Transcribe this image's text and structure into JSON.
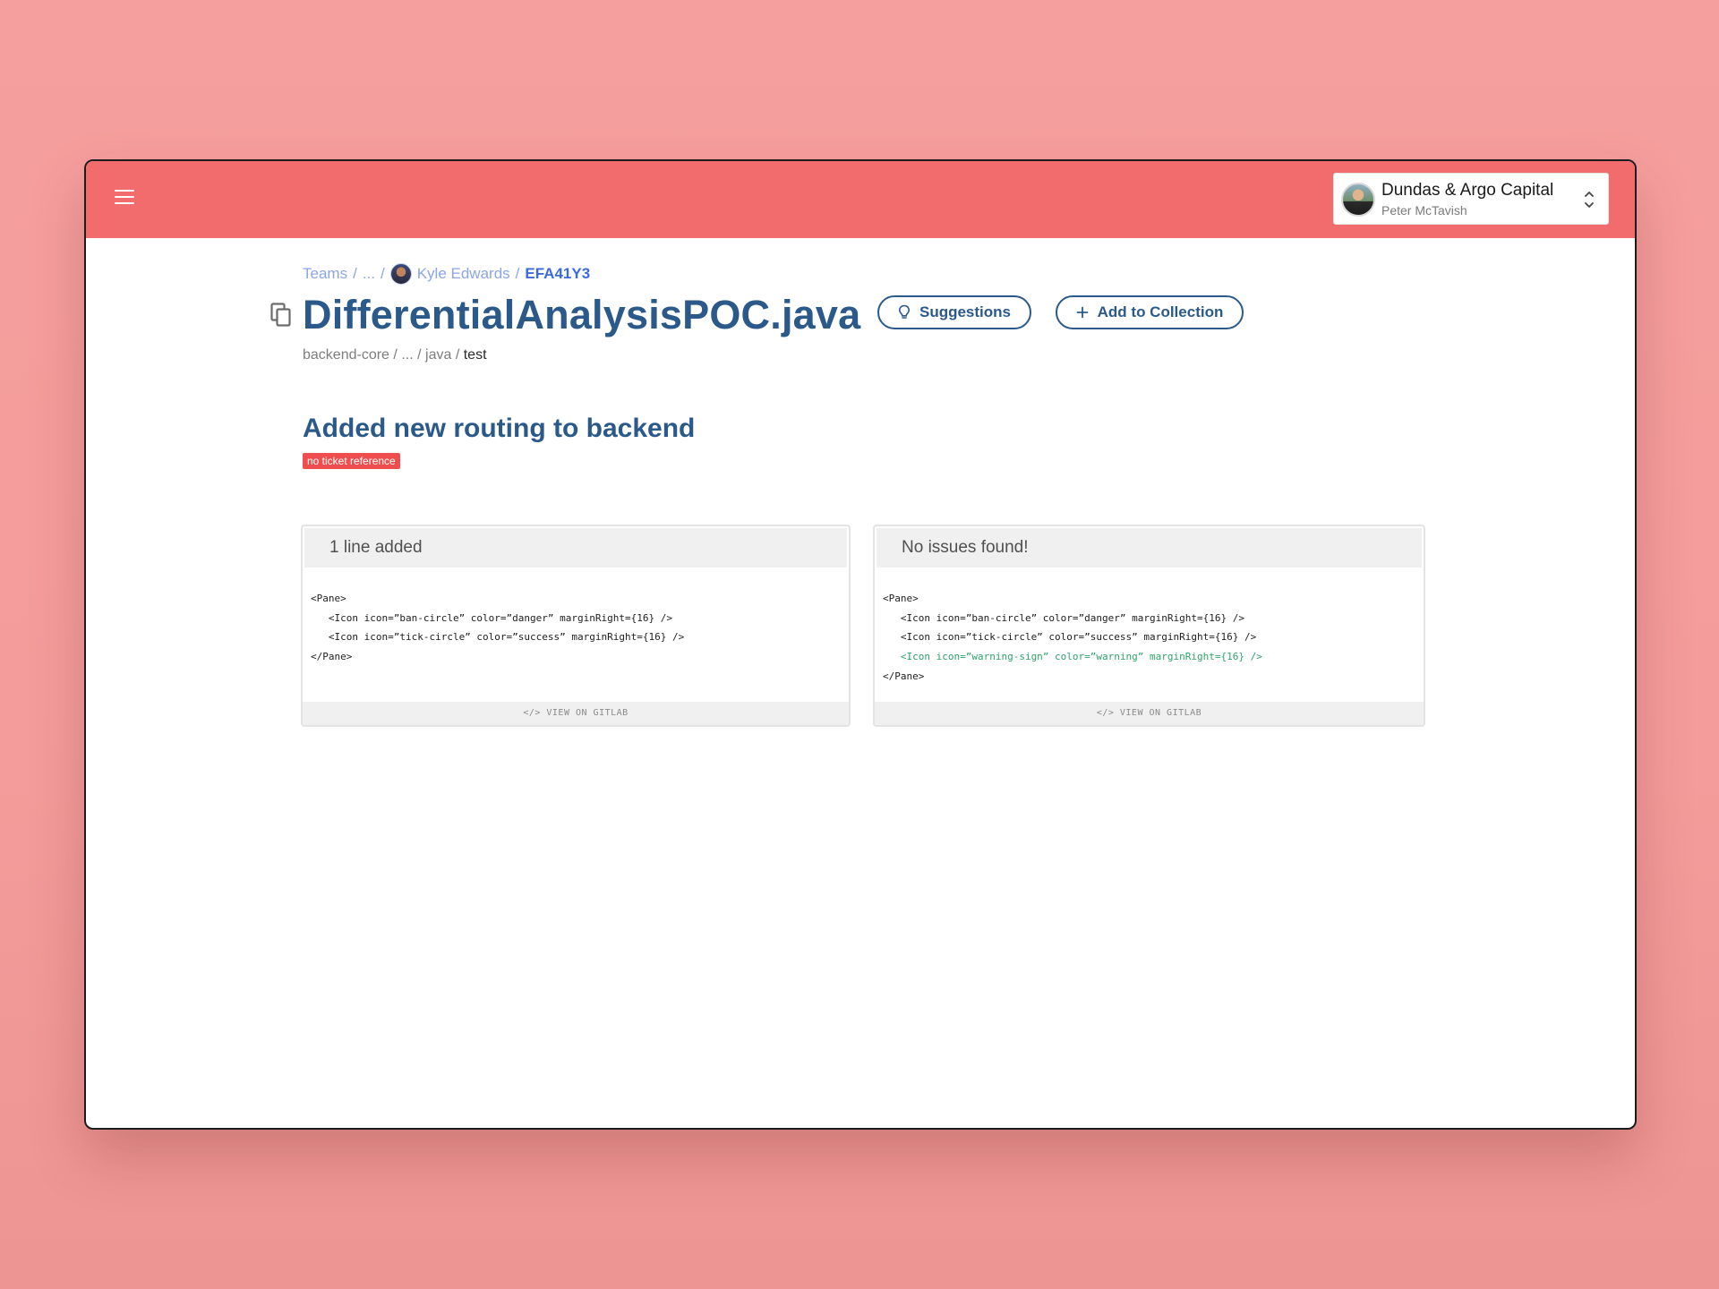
{
  "app": {
    "account": {
      "org": "Dundas & Argo Capital",
      "user": "Peter McTavish"
    }
  },
  "breadcrumb": {
    "teams": "Teams",
    "ellipsis": "...",
    "person": "Kyle Edwards",
    "commit": "EFA41Y3",
    "separator": "/"
  },
  "file": {
    "title": "DifferentialAnalysisPOC.java",
    "path_root": "backend-core",
    "path_ellipsis": "...",
    "path_mid": "java",
    "path_last": "test",
    "path_separator": "/"
  },
  "actions": {
    "suggestions_label": "Suggestions",
    "collection_label": "Add to Collection"
  },
  "commit": {
    "title": "Added new routing to backend",
    "badge": "no ticket reference"
  },
  "panels": {
    "left": {
      "header": "1 line added",
      "code": [
        "<Pane>",
        "   <Icon icon=”ban-circle” color=”danger” marginRight={16} />",
        "   <Icon icon=”tick-circle” color=”success” marginRight={16} />",
        "</Pane>"
      ],
      "footer": "</> VIEW ON GITLAB"
    },
    "right": {
      "header": "No issues found!",
      "code": [
        "<Pane>",
        "   <Icon icon=”ban-circle” color=”danger” marginRight={16} />",
        "   <Icon icon=”tick-circle” color=”success” marginRight={16} />",
        "   <Icon icon=”warning-sign” color=”warning” marginRight={16} />",
        "</Pane>"
      ],
      "footer": "</> VIEW ON GITLAB"
    }
  },
  "colors": {
    "background": "#f59f9e",
    "topbar": "#f26c6d",
    "primary": "#2b5a8a",
    "link": "#8ba6e6",
    "link_active": "#3b6ae0",
    "badge": "#f04e4e",
    "added_code": "#2fa36a"
  },
  "icons": {
    "menu": "hamburger-icon",
    "copy": "copy-icon",
    "suggestions": "lightbulb-icon",
    "add": "plus-icon",
    "switcher": "chevron-up-down-icon"
  }
}
